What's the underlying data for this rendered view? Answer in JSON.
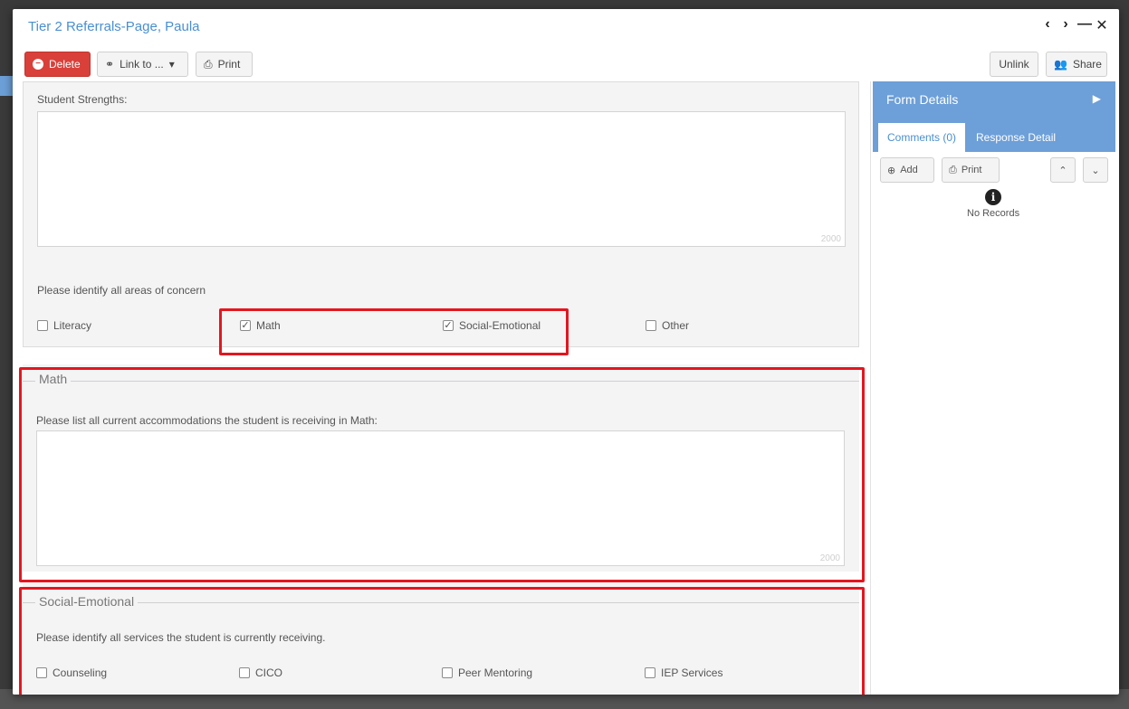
{
  "window": {
    "title": "Tier 2 Referrals-Page, Paula",
    "controls": {
      "prev": "‹",
      "next": "›",
      "minimize": "—",
      "close": "✕"
    }
  },
  "toolbar": {
    "delete_label": "Delete",
    "link_label": "Link to ...",
    "print_label": "Print",
    "unlink_label": "Unlink",
    "share_label": "Share"
  },
  "form": {
    "strengths_label": "Student Strengths:",
    "strengths_counter": "2000",
    "concern_label": "Please identify all areas of concern",
    "concerns": [
      {
        "label": "Literacy",
        "checked": false
      },
      {
        "label": "Math",
        "checked": true
      },
      {
        "label": "Social-Emotional",
        "checked": true
      },
      {
        "label": "Other",
        "checked": false
      }
    ],
    "math_section": {
      "legend": "Math",
      "prompt": "Please list all current accommodations the student is receiving in Math:",
      "counter": "2000"
    },
    "social_section": {
      "legend": "Social-Emotional",
      "prompt": "Please identify all services the student is currently receiving.",
      "services": [
        {
          "label": "Counseling",
          "checked": false
        },
        {
          "label": "CICO",
          "checked": false
        },
        {
          "label": "Peer Mentoring",
          "checked": false
        },
        {
          "label": "IEP Services",
          "checked": false
        }
      ]
    }
  },
  "sidebar": {
    "title": "Form Details",
    "tabs": [
      {
        "label": "Comments (0)",
        "active": true
      },
      {
        "label": "Response Detail",
        "active": false
      }
    ],
    "add_label": "Add",
    "print_label": "Print",
    "empty_text": "No Records"
  },
  "colors": {
    "accent": "#4a8fd1",
    "sidebar_header": "#6d9fd8",
    "delete": "#d9403a",
    "highlight": "#e3161f"
  }
}
